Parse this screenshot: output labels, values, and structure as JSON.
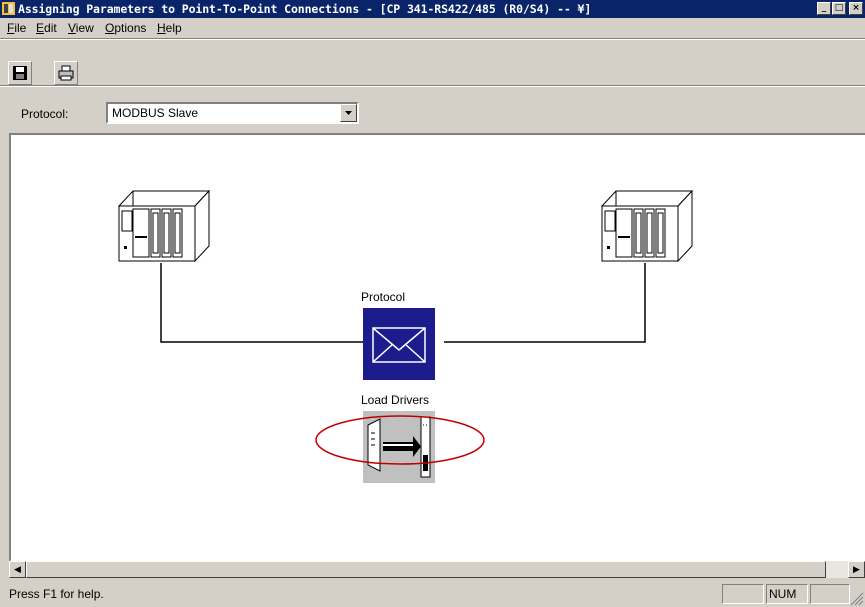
{
  "window": {
    "title": "Assigning Parameters to Point-To-Point Connections - [CP 341-RS422/485 (R0/S4) -- ¥]",
    "controls": [
      "_",
      "□",
      "×"
    ]
  },
  "menu": {
    "file": {
      "mnemonic": "F",
      "rest": "ile"
    },
    "edit": {
      "mnemonic": "E",
      "rest": "dit"
    },
    "view": {
      "mnemonic": "V",
      "rest": "iew"
    },
    "options": {
      "mnemonic": "O",
      "rest": "ptions"
    },
    "help": {
      "mnemonic": "H",
      "rest": "elp"
    }
  },
  "toolbar": {
    "buttons": [
      "save-icon",
      "print-icon"
    ]
  },
  "protocol": {
    "label": "Protocol:",
    "selected": "MODBUS Slave"
  },
  "canvas": {
    "protocol_label": "Protocol",
    "load_drivers_label": "Load Drivers",
    "nodes": [
      "plc-left-icon",
      "plc-right-icon",
      "protocol-envelope-icon",
      "load-drivers-icon"
    ],
    "highlight_color": "#c00000",
    "protocol_icon_color": "#1c1c8c"
  },
  "status": {
    "text": "Press F1 for help.",
    "num_indicator": "NUM"
  }
}
